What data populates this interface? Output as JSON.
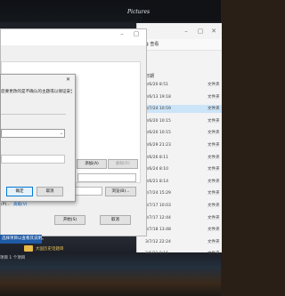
{
  "wallpaper": {
    "logo_text": "Pictures"
  },
  "explorer": {
    "view_label": "查看",
    "column_date": "日期",
    "rows": [
      {
        "date": "3/6/20 8:51",
        "type": "文件夹"
      },
      {
        "date": "3/6/13 19:18",
        "type": "文件夹"
      },
      {
        "date": "3/7/24 10:59",
        "type": "文件夹",
        "selected": true
      },
      {
        "date": "3/6/20 10:15",
        "type": "文件夹"
      },
      {
        "date": "3/6/20 10:15",
        "type": "文件夹"
      },
      {
        "date": "3/6/29 21:23",
        "type": "文件夹"
      },
      {
        "date": "3/6/26 8:11",
        "type": "文件夹"
      },
      {
        "date": "3/6/24 8:10",
        "type": "文件夹"
      },
      {
        "date": "3/6/21 8:14",
        "type": "文件夹"
      },
      {
        "date": "3/7/24 15:29",
        "type": "文件夹"
      },
      {
        "date": "3/7/17 10:03",
        "type": "文件夹"
      },
      {
        "date": "3/7/17 12:44",
        "type": "文件夹"
      },
      {
        "date": "3/7/18 13:48",
        "type": "文件夹"
      },
      {
        "date": "3/7/12 22:24",
        "type": "文件夹"
      },
      {
        "date": "3/6/21 8:16",
        "type": "文件夹"
      }
    ]
  },
  "props": {
    "add_button": "添加(A)",
    "remove_button": "删除(R)",
    "browse_button": "浏览(B)...",
    "advanced_left": "(P)...",
    "advanced_link": "高级(V)",
    "start_button": "开始(S)",
    "cancel_button": "取消"
  },
  "dialog": {
    "message": "您要更改的是不确认的主题或以保证安全性。",
    "ok_button": "确定",
    "cancel_button": "取消"
  },
  "status": {
    "strip_text": "选择项目以查看其说明。",
    "file_label": "大国历史话题目",
    "items_count": "项目 1 个项目"
  }
}
